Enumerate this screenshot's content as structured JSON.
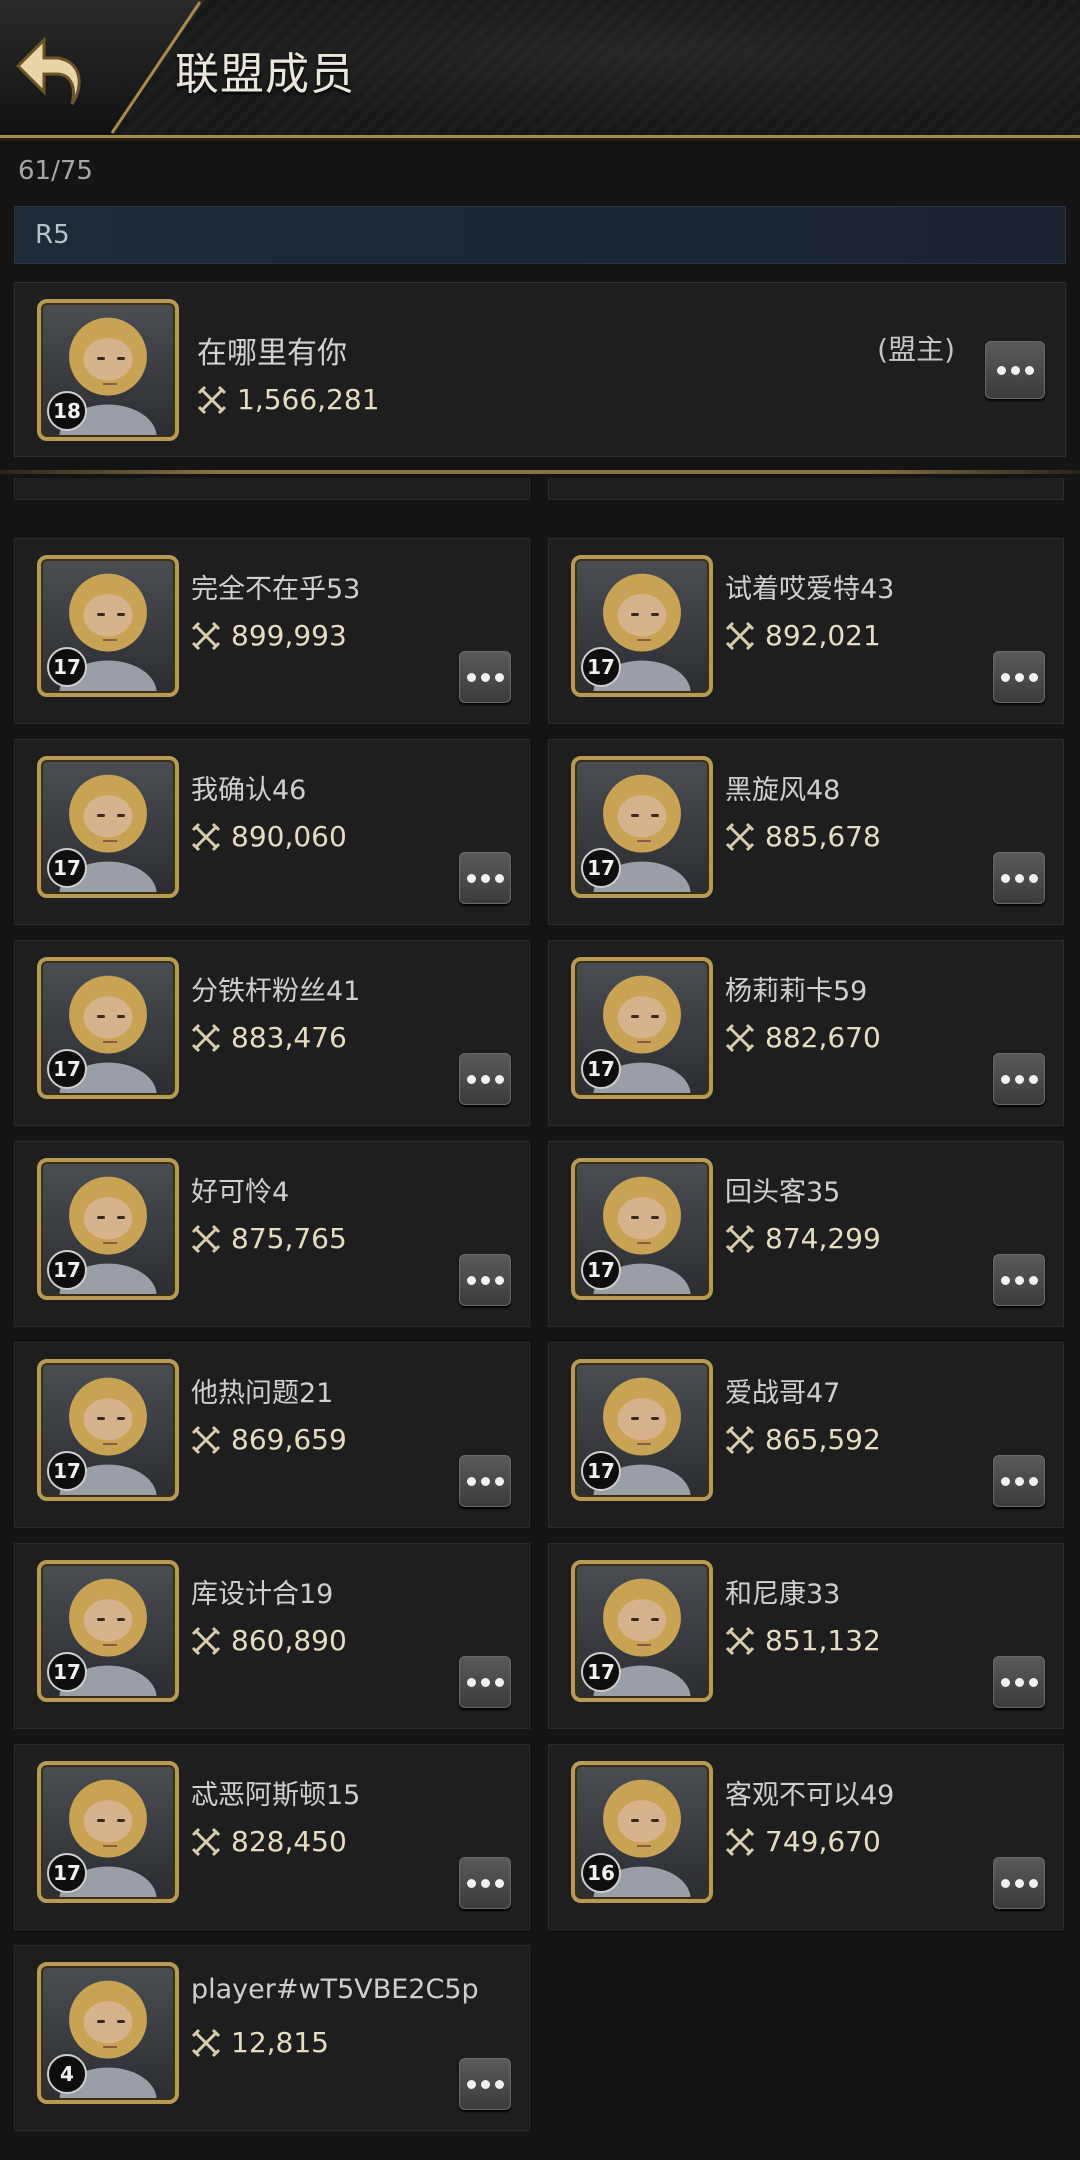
{
  "header": {
    "title": "联盟成员"
  },
  "member_count": "61/75",
  "rank": {
    "label": "R5"
  },
  "leader": {
    "name": "在哪里有你",
    "role": "(盟主)",
    "power": "1,566,281",
    "level": "18"
  },
  "members": [
    {
      "name": "完全不在乎53",
      "power": "899,993",
      "level": "17"
    },
    {
      "name": "试着哎爱特43",
      "power": "892,021",
      "level": "17"
    },
    {
      "name": "我确认46",
      "power": "890,060",
      "level": "17"
    },
    {
      "name": "黑旋风48",
      "power": "885,678",
      "level": "17"
    },
    {
      "name": "分铁杆粉丝41",
      "power": "883,476",
      "level": "17"
    },
    {
      "name": "杨莉莉卡59",
      "power": "882,670",
      "level": "17"
    },
    {
      "name": "好可怜4",
      "power": "875,765",
      "level": "17"
    },
    {
      "name": "回头客35",
      "power": "874,299",
      "level": "17"
    },
    {
      "name": "他热问题21",
      "power": "869,659",
      "level": "17"
    },
    {
      "name": "爱战哥47",
      "power": "865,592",
      "level": "17"
    },
    {
      "name": "库设计合19",
      "power": "860,890",
      "level": "17"
    },
    {
      "name": "和尼康33",
      "power": "851,132",
      "level": "17"
    },
    {
      "name": "忒恶阿斯顿15",
      "power": "828,450",
      "level": "17"
    },
    {
      "name": "客观不可以49",
      "power": "749,670",
      "level": "16"
    },
    {
      "name": "player#wT5VBE2C5p",
      "power": "12,815",
      "level": "4"
    }
  ],
  "icons": {
    "back": "back-arrow-icon",
    "power": "crossed-swords-icon",
    "more": "more-options-icon"
  },
  "colors": {
    "accent_gold": "#b89a55",
    "background": "#141414",
    "card": "#1e1e1e",
    "rank_bar": "#1e2a36"
  }
}
